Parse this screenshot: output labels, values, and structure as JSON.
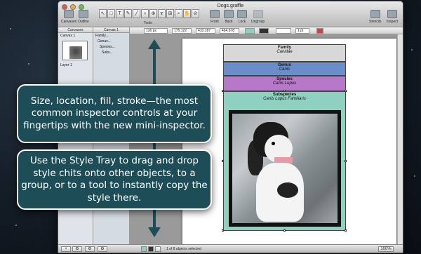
{
  "window": {
    "title": "Dogs.graffle",
    "toolbar": {
      "canvases": "Canvases",
      "outline": "Outline",
      "tools": "Tools",
      "front": "Front",
      "back": "Back",
      "lock": "Lock",
      "ungroup": "Ungroup",
      "stencils": "Stencils",
      "inspect": "Inspect"
    }
  },
  "sidebar": {
    "canvases_header": "Canvases",
    "canvas_item": "Canvas 1",
    "layer_item": "Layer 1"
  },
  "outline": {
    "header": "Canvas 1",
    "items": [
      "Family...",
      "Genus...",
      "Species...",
      "Subs..."
    ]
  },
  "mini_inspector": {
    "x": "136 px",
    "y": "175.122",
    "width": "410.187",
    "height": "464.678",
    "stroke": "1 pt"
  },
  "diagram": {
    "family": {
      "title": "Family",
      "value": "Canidae"
    },
    "genus": {
      "title": "Genus",
      "value": "Canis"
    },
    "species": {
      "title": "Species",
      "value": "Canis Lupus"
    },
    "subspecies": {
      "title": "Subspecies",
      "value": "Canis Lupus Familiaris"
    }
  },
  "status": {
    "selection": "1 of 8 objects selected",
    "zoom": "100%"
  },
  "callouts": {
    "first": "Size, location, fill, stroke—the most common inspector controls at your fingertips with the new mini-inspector.",
    "second": "Use the Style Tray to drag and drop style chits onto other objects, to a group, or to a tool to instantly copy the style there."
  },
  "colors": {
    "callout_bg": "#1d4e58",
    "family": "#d8d8d8",
    "genus": "#6a8ec9",
    "species": "#b778c9",
    "subspecies": "#8fd1c0"
  }
}
